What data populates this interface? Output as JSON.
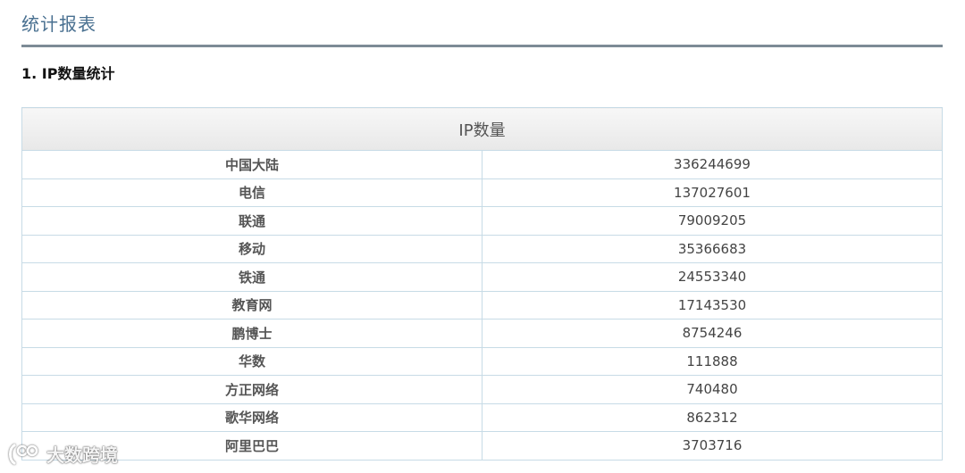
{
  "page": {
    "title": "统计报表"
  },
  "section": {
    "title": "1. IP数量统计"
  },
  "table": {
    "header": "IP数量",
    "rows": [
      {
        "name": "中国大陆",
        "value": "336244699"
      },
      {
        "name": "电信",
        "value": "137027601"
      },
      {
        "name": "联通",
        "value": "79009205"
      },
      {
        "name": "移动",
        "value": "35366683"
      },
      {
        "name": "铁通",
        "value": "24553340"
      },
      {
        "name": "教育网",
        "value": "17143530"
      },
      {
        "name": "鹏博士",
        "value": "8754246"
      },
      {
        "name": "华数",
        "value": "111888"
      },
      {
        "name": "方正网络",
        "value": "740480"
      },
      {
        "name": "歌华网络",
        "value": "862312"
      },
      {
        "name": "阿里巴巴",
        "value": "3703716"
      }
    ]
  },
  "watermark": {
    "text": "大数跨境"
  }
}
